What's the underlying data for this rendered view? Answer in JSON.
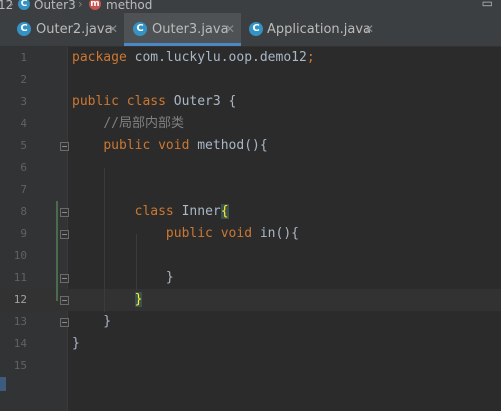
{
  "breadcrumb": {
    "items": [
      {
        "label": "12"
      },
      {
        "icon": "class-icon",
        "icon_letter": "C",
        "label": "Outer3"
      },
      {
        "icon": "method-icon",
        "icon_letter": "m",
        "label": "method"
      }
    ],
    "corner_icon": "window-icon"
  },
  "tabs": [
    {
      "label": "Outer2.java",
      "icon_letter": "C",
      "active": false
    },
    {
      "label": "Outer3.java",
      "icon_letter": "C",
      "active": true
    },
    {
      "label": "Application.java",
      "icon_letter": "C",
      "active": false
    }
  ],
  "editor": {
    "current_line": 12,
    "lines": [
      {
        "n": "1",
        "tokens": [
          [
            "kw",
            "package "
          ],
          [
            "cls",
            "com.luckylu.oop.demo12"
          ],
          [
            "kw",
            ";"
          ]
        ]
      },
      {
        "n": "2",
        "tokens": []
      },
      {
        "n": "3",
        "tokens": [
          [
            "kw",
            "public class "
          ],
          [
            "cls",
            "Outer3 {"
          ]
        ]
      },
      {
        "n": "4",
        "tokens": [
          [
            "cls",
            "    "
          ],
          [
            "cmt",
            "//局部内部类"
          ]
        ]
      },
      {
        "n": "5",
        "tokens": [
          [
            "cls",
            "    "
          ],
          [
            "kw",
            "public void "
          ],
          [
            "cls",
            "method(){"
          ]
        ]
      },
      {
        "n": "6",
        "tokens": []
      },
      {
        "n": "7",
        "tokens": []
      },
      {
        "n": "8",
        "tokens": [
          [
            "cls",
            "        "
          ],
          [
            "kw",
            "class "
          ],
          [
            "cls",
            "Inner"
          ],
          [
            "hl",
            "{"
          ]
        ]
      },
      {
        "n": "9",
        "tokens": [
          [
            "cls",
            "            "
          ],
          [
            "kw",
            "public void "
          ],
          [
            "cls",
            "in(){"
          ]
        ]
      },
      {
        "n": "10",
        "tokens": []
      },
      {
        "n": "11",
        "tokens": [
          [
            "cls",
            "            }"
          ]
        ]
      },
      {
        "n": "12",
        "tokens": [
          [
            "cls",
            "        "
          ],
          [
            "hl",
            "}"
          ]
        ]
      },
      {
        "n": "13",
        "tokens": [
          [
            "cls",
            "    }"
          ]
        ]
      },
      {
        "n": "14",
        "tokens": [
          [
            "cls",
            "}"
          ]
        ]
      },
      {
        "n": "15",
        "tokens": []
      }
    ]
  }
}
